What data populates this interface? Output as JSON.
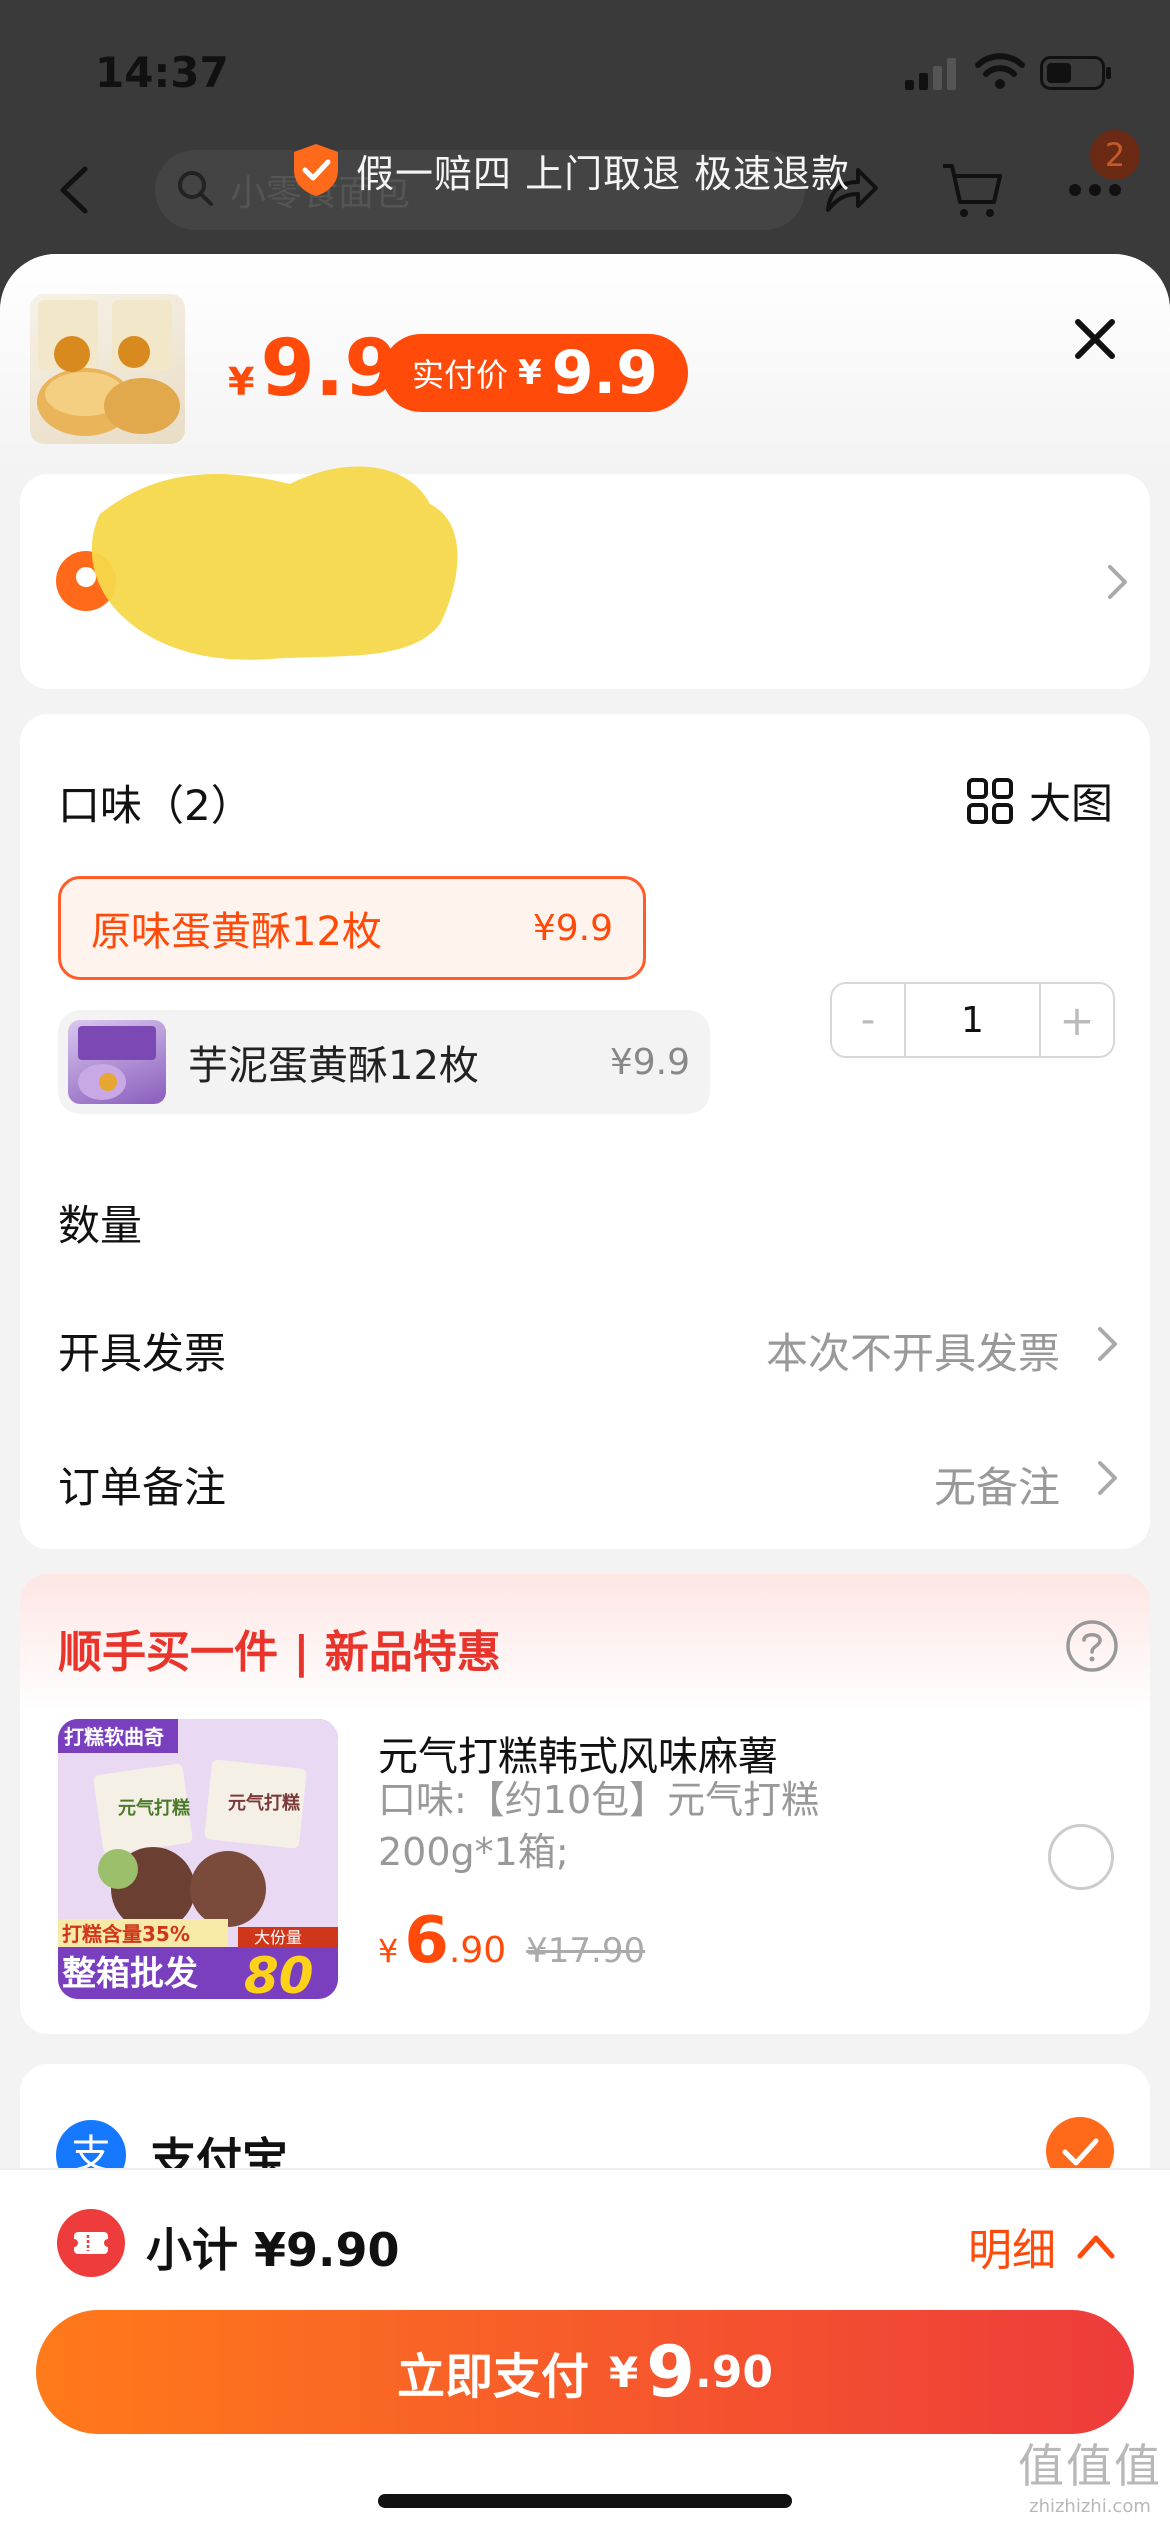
{
  "status_bar": {
    "time": "14:37"
  },
  "background": {
    "search_placeholder": "小零食面包",
    "cart_badge": "2",
    "guarantee": "假一赔四 上门取退 极速退款"
  },
  "sheet": {
    "price": {
      "currency": "¥",
      "value": "9.9"
    },
    "paid_price": {
      "label": "实付价",
      "currency": "¥",
      "value": "9.9"
    },
    "options": {
      "flavor_label": "口味（2）",
      "big_picture": "大图",
      "variants": [
        {
          "name": "原味蛋黄酥12枚",
          "price": "¥9.9",
          "selected": true
        },
        {
          "name": "芋泥蛋黄酥12枚",
          "price": "¥9.9",
          "selected": false
        }
      ],
      "quantity_label": "数量",
      "quantity_value": "1",
      "minus": "-",
      "plus": "+",
      "invoice_label": "开具发票",
      "invoice_value": "本次不开具发票",
      "note_label": "订单备注",
      "note_value": "无备注"
    },
    "promo": {
      "title": "顺手买一件 | 新品特惠",
      "product_name": "元气打糕韩式风味麻薯",
      "spec": "口味:【约10包】元气打糕200g*1箱;",
      "price_currency": "¥",
      "price_int": "6",
      "price_dec": ".90",
      "old_price": "¥17.90",
      "img_tag": "打糕软曲奇",
      "img_badge1": "打糕含量35%",
      "img_badge2": "整箱批发",
      "img_big": "80",
      "img_big_tag": "大份量",
      "img_box_text": "元气打糕"
    },
    "payment": {
      "alipay_icon": "支",
      "alipay_label": "支付宝"
    }
  },
  "bottom": {
    "subtotal": "小计 ¥9.90",
    "detail": "明细",
    "pay_label": "立即支付",
    "pay_currency": "¥",
    "pay_int": "9",
    "pay_dec": ".90"
  },
  "watermark": {
    "cn": "值值值",
    "en": "zhizhizhi.com"
  },
  "colors": {
    "accent": "#ff4a0a",
    "promo_red": "#e8342a",
    "alipay_blue": "#1677ff"
  }
}
